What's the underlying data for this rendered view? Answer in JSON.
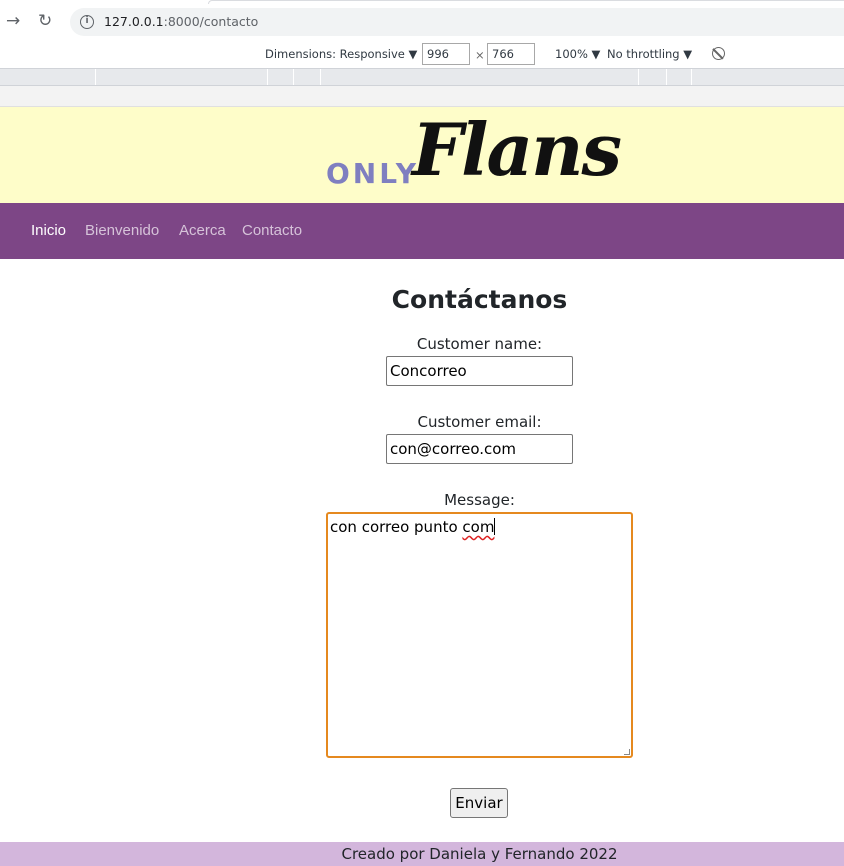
{
  "browser": {
    "back_icon": "arrow-right-icon",
    "reload_icon": "reload-icon",
    "url_host": "127.0.0.1",
    "url_path": ":8000/contacto"
  },
  "devtools_bar": {
    "dimensions_label": "Dimensions: Responsive ▼",
    "width": "996",
    "times": "×",
    "height": "766",
    "zoom": "100% ▼",
    "throttling": "No throttling ▼",
    "rotate_icon": "rotate-icon"
  },
  "site": {
    "logo_only": "ONLY",
    "logo_flans": "Flans",
    "nav": [
      {
        "label": "Inicio",
        "active": true
      },
      {
        "label": "Bienvenido",
        "active": false
      },
      {
        "label": "Acerca",
        "active": false
      },
      {
        "label": "Contacto",
        "active": false
      }
    ],
    "colors": {
      "banner": "#fefdc9",
      "navbar": "#7d4686",
      "footer": "#d3b6dc",
      "textarea_focus": "#e5891f"
    }
  },
  "form": {
    "heading": "Contáctanos",
    "name_label": "Customer name:",
    "name_value": "Concorreo",
    "email_label": "Customer email:",
    "email_value": "con@correo.com",
    "message_label": "Message:",
    "message_value_start": "con correo punto ",
    "message_value_misspelled": "com",
    "submit_label": "Enviar"
  },
  "footer": {
    "text": "Creado por Daniela y Fernando 2022"
  }
}
